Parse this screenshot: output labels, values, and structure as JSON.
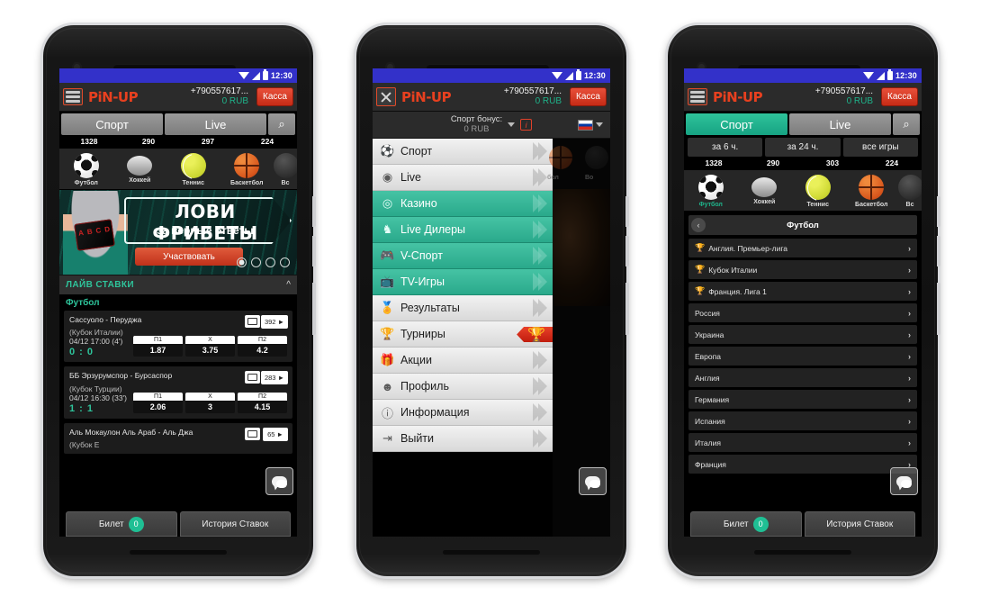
{
  "status_bar": {
    "time": "12:30",
    "icons": [
      "wifi-icon",
      "signal-icon",
      "battery-icon"
    ]
  },
  "brand": {
    "logo": "PiN-UP",
    "accent": "#e8401f",
    "green": "#1fb48b"
  },
  "header": {
    "phone_number": "+790557617...",
    "balance": "0 RUB",
    "kassa_label": "Касса",
    "menu_icon": "hamburger-icon",
    "close_icon": "close-icon"
  },
  "tabs": {
    "sport": "Спорт",
    "live": "Live",
    "search_icon": "search-icon"
  },
  "counts": [
    "1328",
    "290",
    "297",
    "224"
  ],
  "counts_p3": [
    "1328",
    "290",
    "303",
    "224"
  ],
  "time_filters": [
    "за 6 ч.",
    "за 24 ч.",
    "все игры"
  ],
  "sports": [
    {
      "name": "Футбол",
      "icon": "football-ball-icon"
    },
    {
      "name": "Хоккей",
      "icon": "hockey-puck-icon"
    },
    {
      "name": "Теннис",
      "icon": "tennis-ball-icon"
    },
    {
      "name": "Баскетбол",
      "icon": "basketball-ball-icon"
    },
    {
      "name": "Вс",
      "icon": "more-sport-icon"
    }
  ],
  "banner": {
    "title": "ЛОВИ ФРИБЕТЫ",
    "subtitle": "за верные ответы",
    "button": "Участвовать",
    "dots": 4,
    "active_dot": 1
  },
  "live_section": {
    "title": "ЛАЙВ СТАВКИ",
    "collapse_icon": "chevron-up-icon",
    "sport_group": "Футбол",
    "odds_headers": [
      "П1",
      "X",
      "П2"
    ],
    "matches": [
      {
        "teams": "Сассуоло - Перуджа",
        "cup": "(Кубок Италии)",
        "datetime": "04/12 17:00 (4')",
        "score": "0 : 0",
        "count": "392",
        "tv_icon": "tv-icon",
        "odds": [
          "1.87",
          "3.75",
          "4.2"
        ]
      },
      {
        "teams": "ББ Эрзурумспор - Бурсаспор",
        "cup": "(Кубок Турции)",
        "datetime": "04/12 16:30 (33')",
        "score": "1 : 1",
        "count": "283",
        "tv_icon": "tv-icon",
        "odds": [
          "2.06",
          "3",
          "4.15"
        ]
      },
      {
        "teams": "Аль Мокаулон Аль Араб - Аль Джа",
        "cup": "(Кубок Е",
        "datetime": "",
        "score": "",
        "count": "65",
        "tv_icon": "tv-icon",
        "odds": []
      }
    ]
  },
  "drawer": {
    "bonus_label": "Спорт бонус:",
    "bonus_value": "0 RUB",
    "info_icon": "info-icon",
    "language_icon": "russia-flag-icon",
    "items": [
      {
        "label": "Спорт",
        "icon": "football-icon",
        "style": "light",
        "badge": null
      },
      {
        "label": "Live",
        "icon": "live-icon",
        "style": "light",
        "badge": null
      },
      {
        "label": "Казино",
        "icon": "casino-chip-icon",
        "style": "green",
        "badge": null
      },
      {
        "label": "Live Дилеры",
        "icon": "dealer-icon",
        "style": "green",
        "badge": null
      },
      {
        "label": "V-Спорт",
        "icon": "gamepad-icon",
        "style": "green",
        "badge": null
      },
      {
        "label": "TV-Игры",
        "icon": "tv-games-icon",
        "style": "green",
        "badge": null
      },
      {
        "label": "Результаты",
        "icon": "medal-icon",
        "style": "light",
        "badge": null
      },
      {
        "label": "Турниры",
        "icon": "trophy-icon",
        "style": "light",
        "badge": "🏆"
      },
      {
        "label": "Акции",
        "icon": "gift-icon",
        "style": "light",
        "badge": null
      },
      {
        "label": "Профиль",
        "icon": "user-icon",
        "style": "light",
        "badge": null
      },
      {
        "label": "Информация",
        "icon": "info-circle-icon",
        "style": "light",
        "badge": null
      },
      {
        "label": "Выйти",
        "icon": "logout-icon",
        "style": "light",
        "badge": null
      }
    ]
  },
  "league_list": {
    "header": "Футбол",
    "back_icon": "chevron-left-icon",
    "rows": [
      {
        "label": "Англия. Премьер-лига",
        "trophy": true
      },
      {
        "label": "Кубок Италии",
        "trophy": true
      },
      {
        "label": "Франция. Лига 1",
        "trophy": true
      },
      {
        "label": "Россия",
        "trophy": false
      },
      {
        "label": "Украина",
        "trophy": false
      },
      {
        "label": "Европа",
        "trophy": false
      },
      {
        "label": "Англия",
        "trophy": false
      },
      {
        "label": "Германия",
        "trophy": false
      },
      {
        "label": "Испания",
        "trophy": false
      },
      {
        "label": "Италия",
        "trophy": false
      },
      {
        "label": "Франция",
        "trophy": false
      }
    ],
    "arrow_icon": "chevron-right-icon"
  },
  "bottom_bar": {
    "ticket_label": "Билет",
    "ticket_count": "0",
    "history_label": "История Ставок"
  },
  "chat": {
    "icon": "chat-bubble-icon"
  }
}
